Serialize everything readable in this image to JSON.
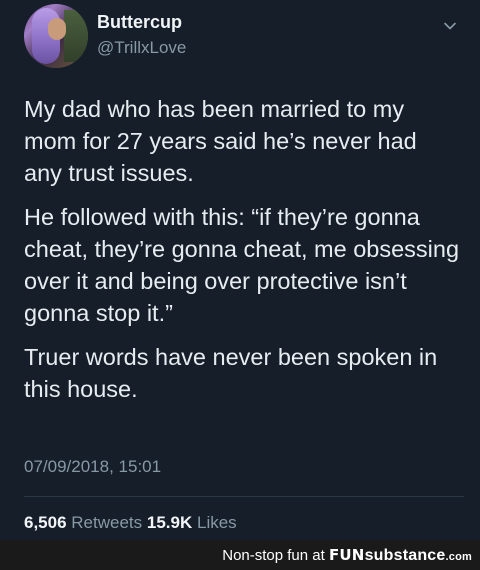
{
  "tweet": {
    "author": {
      "name": "Buttercup",
      "handle": "@TrillxLove"
    },
    "paragraphs": [
      "My dad who has been married to my mom for 27 years said he’s never had any trust issues.",
      "He followed with this: “if they’re gonna cheat, they’re gonna cheat, me obsessing over it and being over protective isn’t gonna stop it.”",
      "Truer words have never been spoken in this house."
    ],
    "timestamp": "07/09/2018, 15:01",
    "stats": {
      "retweets_count": "6,506",
      "retweets_label": "Retweets",
      "likes_count": "15.9K",
      "likes_label": "Likes"
    }
  },
  "footer": {
    "tagline": "Non-stop fun at",
    "brand_fun": "FUN",
    "brand_sub": "substance",
    "brand_com": ".com"
  },
  "colors": {
    "background": "#151e29",
    "text": "#e7ecf0",
    "muted": "#8899a6",
    "footer_bg": "#1a1a1a"
  },
  "icons": {
    "menu": "chevron-down-icon"
  }
}
